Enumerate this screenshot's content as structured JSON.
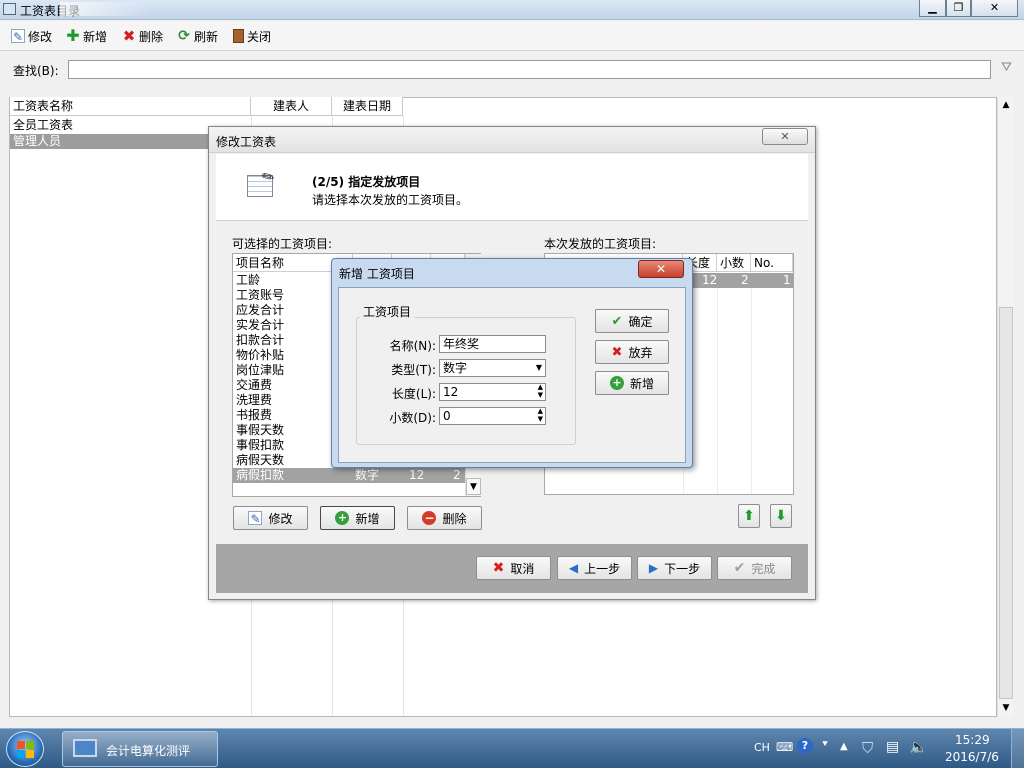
{
  "main": {
    "title": "工资表目录",
    "toolbar": {
      "edit": "修改",
      "add": "新增",
      "delete": "删除",
      "refresh": "刷新",
      "close": "关闭"
    },
    "search_label": "查找(B):",
    "columns": [
      "工资表名称",
      "建表人",
      "建表日期"
    ],
    "rows": [
      {
        "name": "全员工资表"
      },
      {
        "name": "管理人员"
      }
    ]
  },
  "wizard": {
    "title": "修改工资表",
    "step": "(2/5)  指定发放项目",
    "subtitle": "请选择本次发放的工资项目。",
    "available_label": "可选择的工资项目:",
    "selected_label": "本次发放的工资项目:",
    "available_header": "项目名称",
    "available_items": [
      "工龄",
      "工资账号",
      "应发合计",
      "实发合计",
      "扣款合计",
      "物价补贴",
      "岗位津贴",
      "交通费",
      "洗理费",
      "书报费",
      "事假天数",
      "事假扣款",
      "病假天数",
      "病假扣款"
    ],
    "last_item_type": "数字",
    "last_item_length": "12",
    "last_item_decimal": "2",
    "selected_headers": [
      "长度",
      "小数",
      "No."
    ],
    "selected_row": {
      "length": "12",
      "decimal": "2",
      "no": "1"
    },
    "list_buttons": {
      "edit": "修改",
      "add": "新增",
      "delete": "删除"
    },
    "footer_buttons": {
      "cancel": "取消",
      "prev": "上一步",
      "next": "下一步",
      "finish": "完成"
    }
  },
  "dialog": {
    "title": "新增 工资项目",
    "group": "工资项目",
    "name_label": "名称(N):",
    "name_value": "年终奖",
    "type_label": "类型(T):",
    "type_value": "数字",
    "length_label": "长度(L):",
    "length_value": "12",
    "decimal_label": "小数(D):",
    "decimal_value": "0",
    "buttons": {
      "ok": "确定",
      "discard": "放弃",
      "add": "新增"
    }
  },
  "taskbar": {
    "task_label": "会计电算化测评",
    "lang": "CH",
    "time": "15:29",
    "date": "2016/7/6"
  }
}
